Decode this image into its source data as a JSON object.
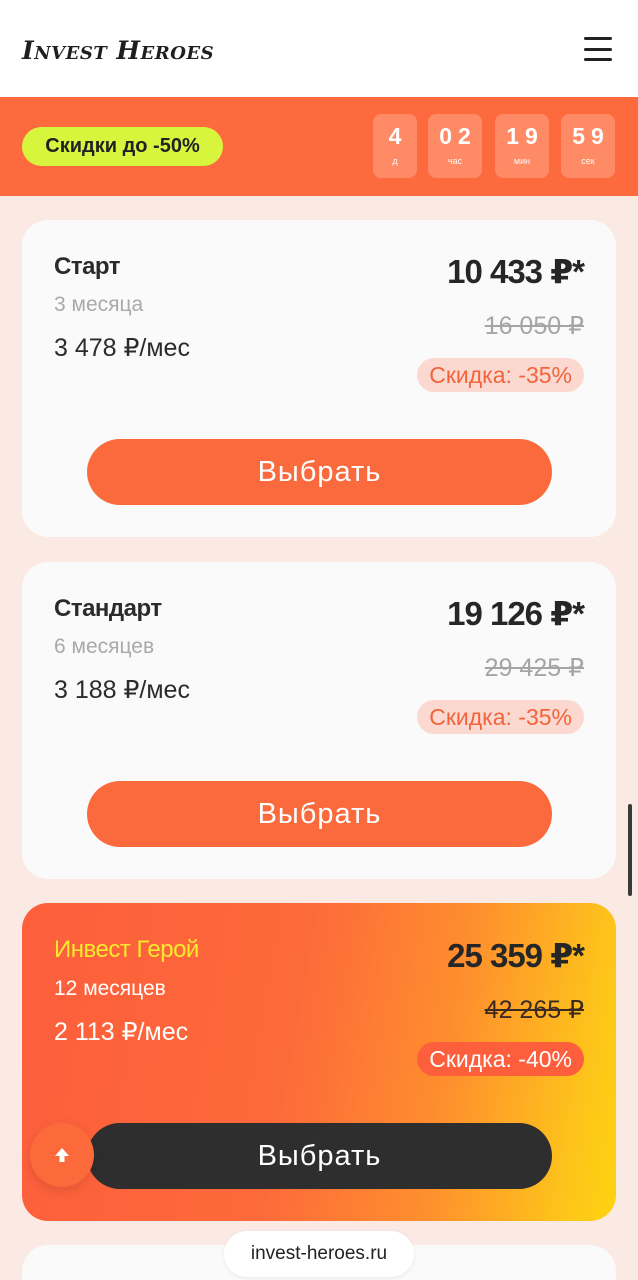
{
  "header": {
    "logo": "Invest Heroes",
    "menu_icon": "hamburger-menu-icon"
  },
  "promo": {
    "badge": "Скидки до -50%",
    "timer": [
      {
        "value": "4",
        "unit": "д"
      },
      {
        "value": "02",
        "unit": "час"
      },
      {
        "value": "19",
        "unit": "мин"
      },
      {
        "value": "59",
        "unit": "сек"
      }
    ]
  },
  "plans": [
    {
      "name": "Старт",
      "period": "3 месяца",
      "monthly": "3 478 ₽/мес",
      "price": "10 433 ₽*",
      "old_price": "16 050 ₽",
      "discount": "Скидка: -35%",
      "button": "Выбрать"
    },
    {
      "name": "Стандарт",
      "period": "6 месяцев",
      "monthly": "3 188 ₽/мес",
      "price": "19 126 ₽*",
      "old_price": "29 425 ₽",
      "discount": "Скидка: -35%",
      "button": "Выбрать"
    },
    {
      "name": "Инвест Герой",
      "period": "12 месяцев",
      "monthly": "2 113 ₽/мес",
      "price": "25 359 ₽*",
      "old_price": "42 265 ₽",
      "discount": "Скидка: -40%",
      "button": "Выбрать"
    }
  ],
  "scroll_top_icon": "arrow-up-icon",
  "url_bar": "invest-heroes.ru",
  "colors": {
    "accent": "#fd6a3d",
    "promo_badge": "#d8f53d",
    "hero_gradient_end": "#fdd30f"
  }
}
